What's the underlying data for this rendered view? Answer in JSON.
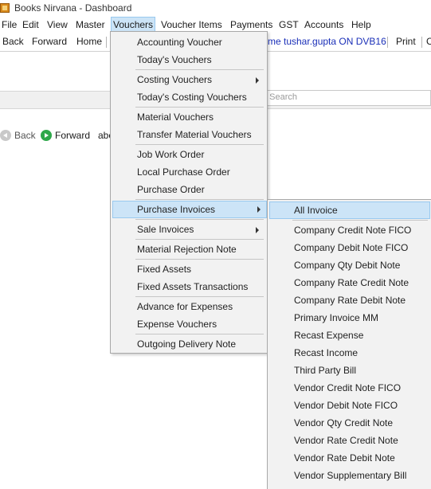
{
  "window": {
    "title": "Books Nirvana - Dashboard"
  },
  "menubar": {
    "items": [
      {
        "key": "file",
        "label": "File"
      },
      {
        "key": "edit",
        "label": "Edit"
      },
      {
        "key": "view",
        "label": "View"
      },
      {
        "key": "master",
        "label": "Master"
      },
      {
        "key": "vouchers",
        "label": "Vouchers"
      },
      {
        "key": "voucher-items",
        "label": "Voucher Items"
      },
      {
        "key": "payments",
        "label": "Payments"
      },
      {
        "key": "gst",
        "label": "GST"
      },
      {
        "key": "accounts",
        "label": "Accounts"
      },
      {
        "key": "help",
        "label": "Help"
      }
    ]
  },
  "toolbar": {
    "back": "Back",
    "forward": "Forward",
    "home": "Home",
    "welcome": "me tushar.gupta ON DVB16",
    "print": "Print",
    "overflow": "C"
  },
  "search": {
    "placeholder": "o Search"
  },
  "nav": {
    "back": "Back",
    "forward": "Forward",
    "address": "abc"
  },
  "vouchers_menu": {
    "items": [
      {
        "key": "accounting-voucher",
        "label": "Accounting Voucher"
      },
      {
        "key": "todays-vouchers",
        "label": "Today's Vouchers"
      },
      {
        "key": "costing-vouchers",
        "label": "Costing Vouchers",
        "submenu": true
      },
      {
        "key": "todays-costing-vouchers",
        "label": "Today's Costing Vouchers"
      },
      {
        "key": "material-vouchers",
        "label": "Material Vouchers"
      },
      {
        "key": "transfer-material-vouchers",
        "label": "Transfer Material Vouchers"
      },
      {
        "key": "job-work-order",
        "label": "Job Work Order"
      },
      {
        "key": "local-purchase-order",
        "label": "Local Purchase Order"
      },
      {
        "key": "purchase-order",
        "label": "Purchase Order"
      },
      {
        "key": "purchase-invoices",
        "label": "Purchase Invoices",
        "submenu": true,
        "highlighted": true
      },
      {
        "key": "sale-invoices",
        "label": "Sale Invoices",
        "submenu": true
      },
      {
        "key": "material-rejection-note",
        "label": "Material Rejection Note"
      },
      {
        "key": "fixed-assets",
        "label": "Fixed Assets"
      },
      {
        "key": "fixed-assets-transactions",
        "label": "Fixed Assets Transactions"
      },
      {
        "key": "advance-for-expenses",
        "label": "Advance for Expenses"
      },
      {
        "key": "expense-vouchers",
        "label": "Expense Vouchers"
      },
      {
        "key": "outgoing-delivery-note",
        "label": "Outgoing Delivery Note"
      }
    ]
  },
  "purchase_invoices_menu": {
    "items": [
      {
        "key": "all-invoice",
        "label": "All Invoice",
        "highlighted": true
      },
      {
        "key": "company-credit-note-fico",
        "label": "Company Credit Note FICO"
      },
      {
        "key": "company-debit-note-fico",
        "label": "Company Debit Note FICO"
      },
      {
        "key": "company-qty-debit-note",
        "label": "Company Qty Debit Note"
      },
      {
        "key": "company-rate-credit-note",
        "label": "Company Rate Credit Note"
      },
      {
        "key": "company-rate-debit-note",
        "label": "Company Rate Debit Note"
      },
      {
        "key": "primary-invoice-mm",
        "label": "Primary Invoice MM"
      },
      {
        "key": "recast-expense",
        "label": "Recast Expense"
      },
      {
        "key": "recast-income",
        "label": "Recast Income"
      },
      {
        "key": "third-party-bill",
        "label": "Third Party Bill"
      },
      {
        "key": "vendor-credit-note-fico",
        "label": "Vendor Credit Note FICO"
      },
      {
        "key": "vendor-debit-note-fico",
        "label": "Vendor Debit Note FICO"
      },
      {
        "key": "vendor-qty-credit-note",
        "label": "Vendor Qty Credit Note"
      },
      {
        "key": "vendor-rate-credit-note",
        "label": "Vendor Rate Credit Note"
      },
      {
        "key": "vendor-rate-debit-note",
        "label": "Vendor Rate Debit Note"
      },
      {
        "key": "vendor-supplementary-bill",
        "label": "Vendor Supplementary Bill"
      }
    ]
  }
}
